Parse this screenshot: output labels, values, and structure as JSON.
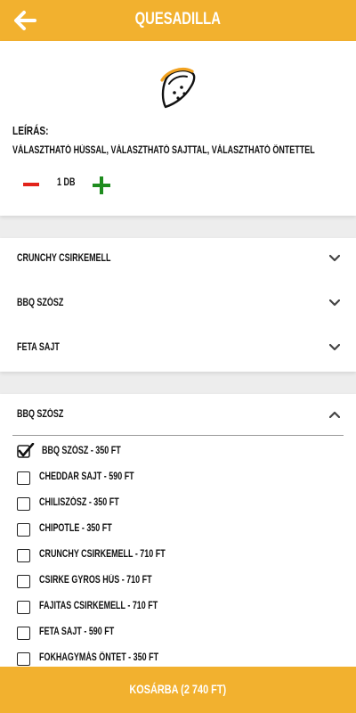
{
  "header": {
    "title": "QUESADILLA"
  },
  "product": {
    "icon": "taco-icon",
    "description_label": "LEÍRÁS:",
    "description": "VÁLASZTHATÓ HÚSSAL, VÁLASZTHATÓ SAJTTAL, VÁLASZTHATÓ ÖNTETTEL",
    "quantity": "1 DB"
  },
  "accordions": [
    {
      "label": "CRUNCHY CSIRKEMELL",
      "expanded": false
    },
    {
      "label": "BBQ SZÓSZ",
      "expanded": false
    },
    {
      "label": "FETA SAJT",
      "expanded": false
    }
  ],
  "open_section": {
    "label": "BBQ SZÓSZ",
    "expanded": true,
    "options": [
      {
        "label": "BBQ SZÓSZ - 350 FT",
        "checked": true
      },
      {
        "label": "CHEDDAR SAJT - 590 FT",
        "checked": false
      },
      {
        "label": "CHILISZÓSZ - 350 FT",
        "checked": false
      },
      {
        "label": "CHIPOTLE - 350 FT",
        "checked": false
      },
      {
        "label": "CRUNCHY CSIRKEMELL - 710 FT",
        "checked": false
      },
      {
        "label": "CSIRKE GYROS HÚS - 710 FT",
        "checked": false
      },
      {
        "label": "FAJITAS CSIRKEMELL - 710 FT",
        "checked": false
      },
      {
        "label": "FETA SAJT - 590 FT",
        "checked": false
      },
      {
        "label": "FOKHAGYMÁS ÖNTET - 350 FT",
        "checked": false
      }
    ]
  },
  "footer": {
    "cart_button": "KOSÁRBA (2 740 FT)"
  },
  "colors": {
    "accent": "#f2b12f",
    "minus": "#e2231a",
    "plus": "#1e8c1e"
  }
}
